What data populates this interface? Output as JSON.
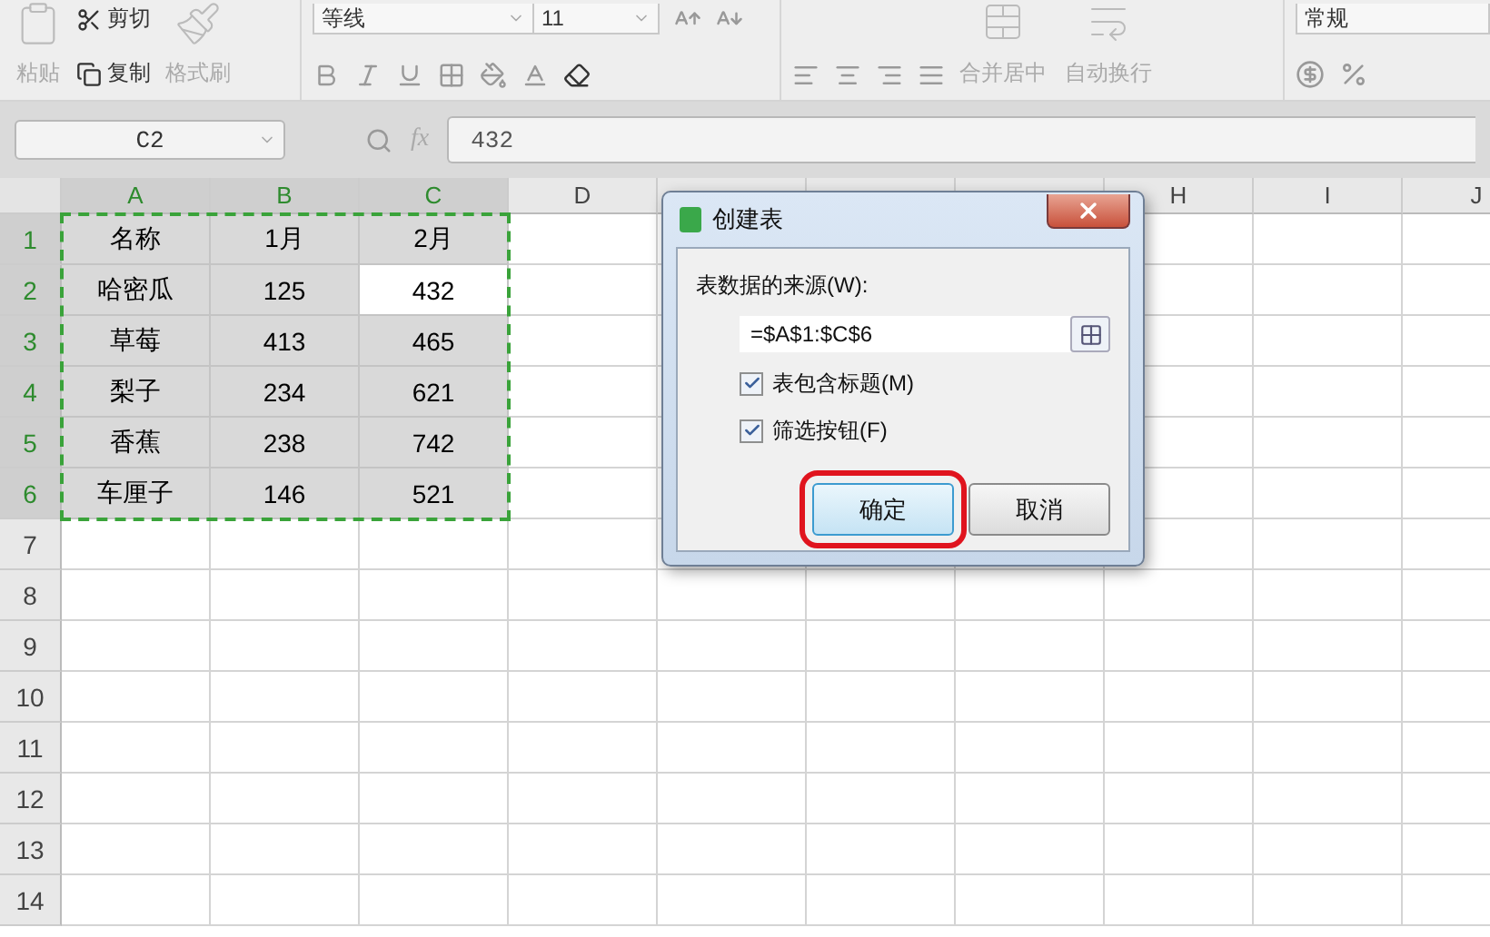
{
  "ribbon": {
    "clipboard": {
      "paste": "粘贴",
      "cut": "剪切",
      "copy": "复制",
      "format_painter": "格式刷"
    },
    "font": {
      "name": "等线",
      "size": "11"
    },
    "alignment": {
      "merge": "合并居中",
      "wrap": "自动换行"
    },
    "number": {
      "format": "常规"
    }
  },
  "formula_bar": {
    "cell": "C2",
    "fx": "fx",
    "value": "432"
  },
  "sheet": {
    "columns": [
      {
        "label": "A",
        "highlighted": true
      },
      {
        "label": "B",
        "highlighted": true
      },
      {
        "label": "C",
        "highlighted": true
      },
      {
        "label": "D",
        "highlighted": false
      },
      {
        "highlighted": false
      },
      {
        "highlighted": false
      },
      {
        "highlighted": false
      },
      {
        "label": "H",
        "highlighted": false
      },
      {
        "label": "I",
        "highlighted": false
      },
      {
        "label": "J",
        "highlighted": false
      }
    ],
    "rows": [
      {
        "number": "1",
        "highlighted": true,
        "cells": [
          {
            "text": "名称",
            "active": false
          },
          {
            "text": "1月",
            "active": false
          },
          {
            "text": "2月",
            "active": false
          }
        ]
      },
      {
        "number": "2",
        "highlighted": true,
        "cells": [
          {
            "text": "哈密瓜",
            "active": false
          },
          {
            "text": "125",
            "active": false
          },
          {
            "text": "432",
            "active": true
          }
        ]
      },
      {
        "number": "3",
        "highlighted": true,
        "cells": [
          {
            "text": "草莓",
            "active": false
          },
          {
            "text": "413",
            "active": false
          },
          {
            "text": "465",
            "active": false
          }
        ]
      },
      {
        "number": "4",
        "highlighted": true,
        "cells": [
          {
            "text": "梨子",
            "active": false
          },
          {
            "text": "234",
            "active": false
          },
          {
            "text": "621",
            "active": false
          }
        ]
      },
      {
        "number": "5",
        "highlighted": true,
        "cells": [
          {
            "text": "香蕉",
            "active": false
          },
          {
            "text": "238",
            "active": false
          },
          {
            "text": "742",
            "active": false
          }
        ]
      },
      {
        "number": "6",
        "highlighted": true,
        "cells": [
          {
            "text": "车厘子",
            "active": false
          },
          {
            "text": "146",
            "active": false
          },
          {
            "text": "521",
            "active": false
          }
        ]
      },
      {
        "number": "7",
        "highlighted": false
      },
      {
        "number": "8",
        "highlighted": false
      },
      {
        "number": "9",
        "highlighted": false
      },
      {
        "number": "10",
        "highlighted": false
      },
      {
        "number": "11",
        "highlighted": false
      },
      {
        "number": "12",
        "highlighted": false
      },
      {
        "number": "13",
        "highlighted": false
      },
      {
        "number": "14",
        "highlighted": false
      }
    ]
  },
  "dialog": {
    "title": "创建表",
    "source_label": "表数据的来源(W):",
    "source_value": "=$A$1:$C$6",
    "options": [
      {
        "label": "表包含标题(M)",
        "checked": true
      },
      {
        "label": "筛选按钮(F)",
        "checked": true
      }
    ],
    "buttons": [
      {
        "label": "确定",
        "highlighted": true
      },
      {
        "label": "取消",
        "highlighted": false
      }
    ]
  }
}
